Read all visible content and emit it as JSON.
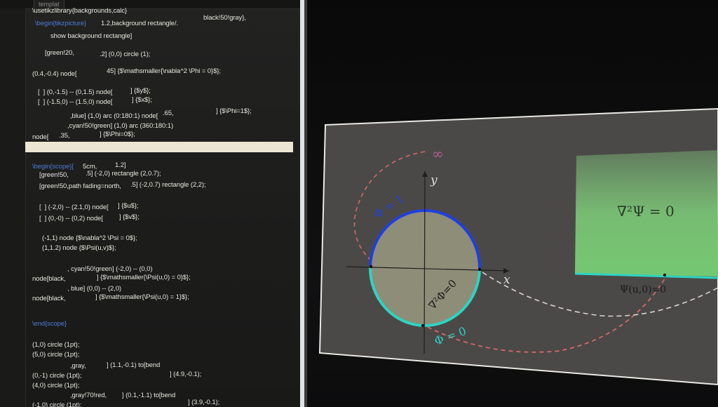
{
  "tabs": {
    "main": "",
    "template": "templat"
  },
  "code": {
    "lines_top": [
      "\\usetikzlibrary{backgrounds,calc}",
      "1.2,background rectangle/.",
      "black!50!gray},",
      "show background rectangle]",
      "[green!20,",
      ".2] (0,0) circle (1);",
      "(0.4,-0.4) node[",
      "45] {$\\mathsmaller{\\nabla^2 \\Phi = 0}$};",
      "[  ] (0,-1.5) -- (0,1.5) node[",
      "] {$y$};",
      "[  ] (-1.5,0) -- (1.5,0) node[",
      "] {$x$};",
      ",blue] (1,0) arc (0:180:1) node[",
      ".65,",
      "] {$\\Phi=1$};",
      ",cyan!50!green] (1,0) arc (360:180:1)",
      "node[",
      ".35,",
      "] {$\\Phi=0$};"
    ],
    "lines_bottom": [
      "5cm,",
      "1.2]",
      "[green!50,",
      ".5] (-2,0) rectangle (2,0.7);",
      "[green!50,path fading=north,",
      ".5] (-2,0.7) rectangle (2,2);",
      "[  ] (-2,0) -- (2.1,0) node[",
      "] {$u$};",
      "[  ] (0,-0) -- (0,2) node[",
      "] {$v$};",
      "(-1,1) node {$\\nabla^2 \\Psi = 0$};",
      "(1,1.2) node {$\\Psi(u,v)$};",
      ", cyan!50!green] (-2,0) -- (0,0)",
      "node[black,",
      "] {$\\mathsmaller{\\Psi(u,0) = 0}$};",
      ", blue] (0,0) -- (2,0)",
      "node[black,",
      "] {$\\mathsmaller{\\Psi(u,0) = 1}$};",
      "\\end{scope}",
      "(1,0) circle (1pt);",
      "(5,0) circle (1pt);",
      ",gray,",
      "] (1.1,-0.1) to[bend",
      "] (4.9,-0.1);",
      "(0,-1) circle (1pt);",
      "(4,0) circle (1pt);",
      ",gray!70!red,",
      "] (0.1,-1.1) to[bend",
      "] (3.9,-0.1);",
      "(-1,0) circle (1pt);"
    ]
  },
  "figure": {
    "infinity": "∞",
    "y_axis": "y",
    "x_axis": "x",
    "phi_one": "Φ = 1",
    "phi_zero": "Φ = 0",
    "laplace_phi": "∇²Φ=0",
    "laplace_psi": "∇²Ψ = 0",
    "psi_label": "Ψ(u,0)=0"
  },
  "colors": {
    "blue_arc": "#1f3fe0",
    "cyan_arc": "#2ed3c2",
    "green_rect": "#7fcf7a",
    "disc_fill": "#8e8d78",
    "slide_bg": "#4a4846",
    "red_dash": "#d06a6a"
  }
}
